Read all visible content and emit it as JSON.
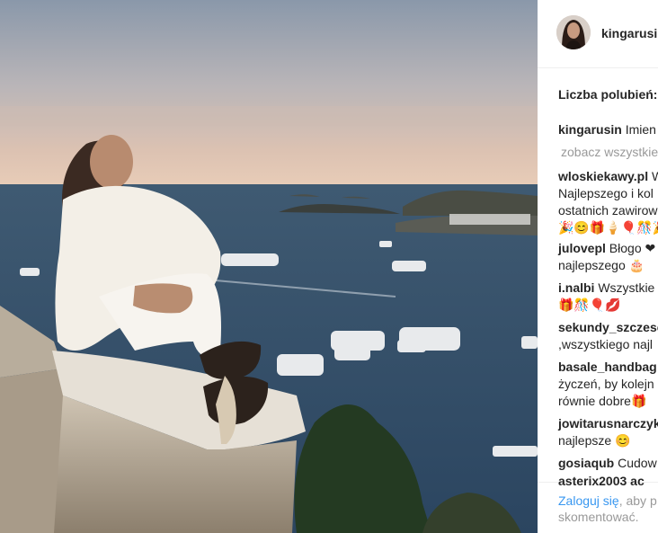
{
  "post": {
    "username": "kingarusin",
    "likes_label": "Liczba polubień:",
    "view_all": "zobacz wszystkie",
    "comments": [
      {
        "user": "kingarusin",
        "lines": [
          "Imien"
        ]
      },
      {
        "user": "wloskiekawy.pl",
        "lines": [
          "W",
          "Najlepszego i kol",
          "ostatnich zawirow"
        ],
        "emoji": "🎉😊🎁🍦🎈🎊🎉"
      },
      {
        "user": "julovepl",
        "lines": [
          "Błogo ❤",
          "najlepszego 🎂"
        ]
      },
      {
        "user": "i.nalbi",
        "lines": [
          "Wszystkie",
          "🎁🎊🎈💋"
        ]
      },
      {
        "user": "sekundy_szczesc",
        "lines": [
          "",
          ",wszystkiego najl"
        ]
      },
      {
        "user": "basale_handbag",
        "lines": [
          "",
          "życzeń, by kolejn",
          "równie dobre🎁"
        ]
      },
      {
        "user": "jowitarusnarczyk",
        "lines": [
          "",
          "najlepsze 😊"
        ]
      },
      {
        "user": "gosiaqub",
        "lines": [
          "Cudow"
        ]
      }
    ],
    "cut_user": "asterix2003 ac",
    "login_link": "Zaloguj się",
    "login_rest": ", aby p",
    "login_line2": "skomentować."
  }
}
